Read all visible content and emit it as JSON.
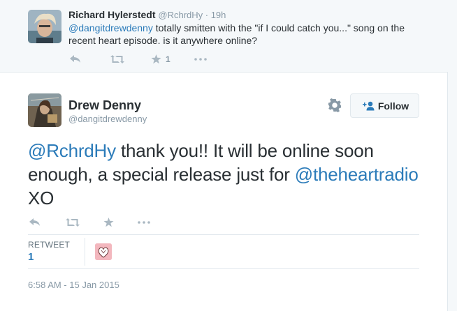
{
  "parent_tweet": {
    "name": "Richard Hylerstedt",
    "handle": "@RchrdHy",
    "separator": " · ",
    "time": "19h",
    "mention": "@dangitdrewdenny",
    "text": " totally smitten with the \"if I could catch you...\" song on the recent heart episode. is it anywhere online?",
    "favorite_count": "1"
  },
  "main_tweet": {
    "name": "Drew Denny",
    "handle": "@dangitdrewdenny",
    "follow_label": "Follow",
    "mention_1": "@RchrdHy",
    "text_1": " thank you!! It will be online soon enough, a special release just for ",
    "mention_2": "@theheartradio",
    "text_2": " XO",
    "retweet_label": "RETWEET",
    "retweet_count": "1",
    "timestamp": "6:58 AM - 15 Jan 2015"
  },
  "colors": {
    "link": "#2b7bb9",
    "muted": "#8899a6",
    "text": "#292f33",
    "parent_bg": "#f5f8fa",
    "border": "#e1e8ed"
  }
}
